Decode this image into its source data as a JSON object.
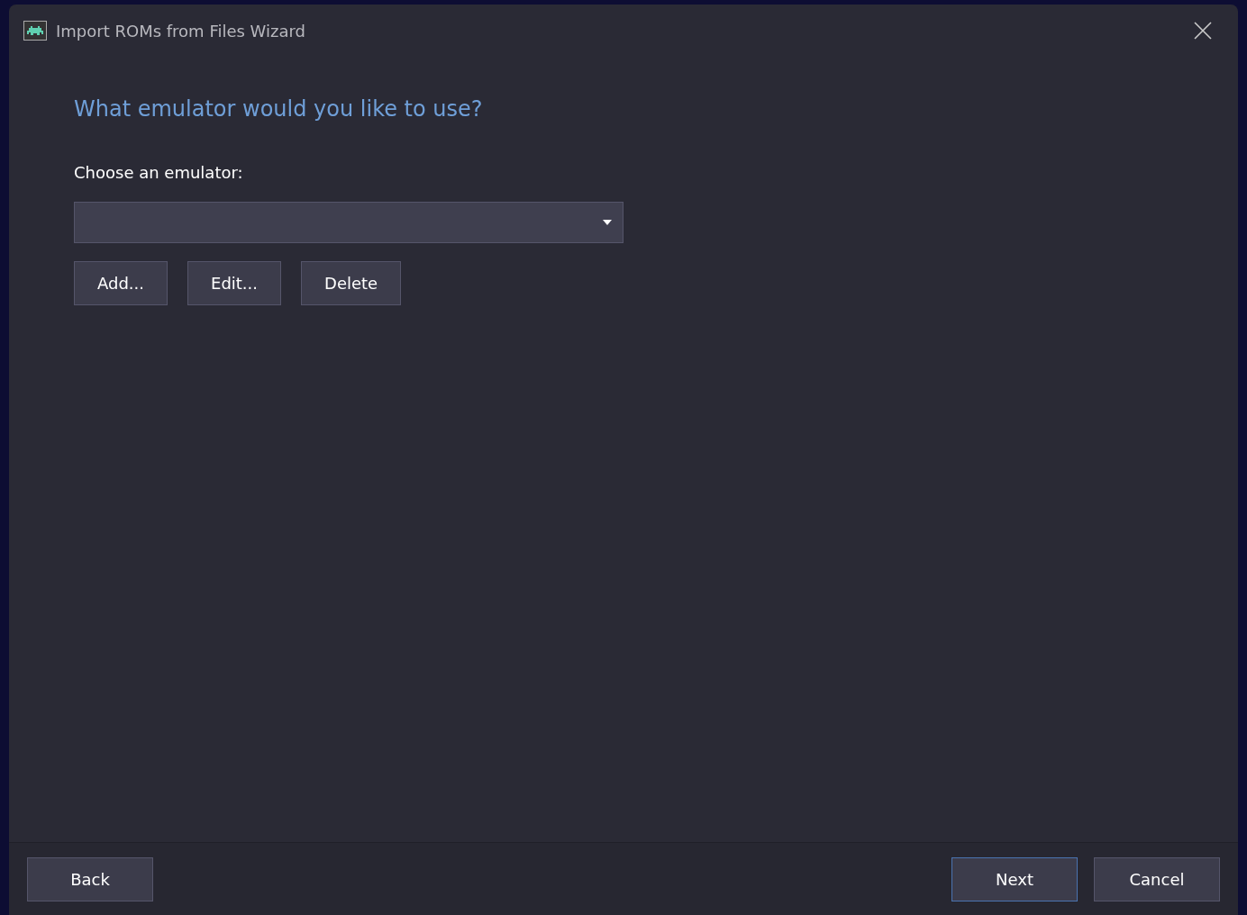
{
  "window": {
    "title": "Import ROMs from Files Wizard"
  },
  "heading": "What emulator would you like to use?",
  "emulator_label": "Choose an emulator:",
  "list_buttons": [
    "Add...",
    "Edit...",
    "Delete"
  ],
  "back_button": {
    "label": "Back",
    "default": false
  },
  "footer_buttons": [
    {
      "label": "Next",
      "default": true
    },
    {
      "label": "Cancel",
      "default": false
    }
  ]
}
